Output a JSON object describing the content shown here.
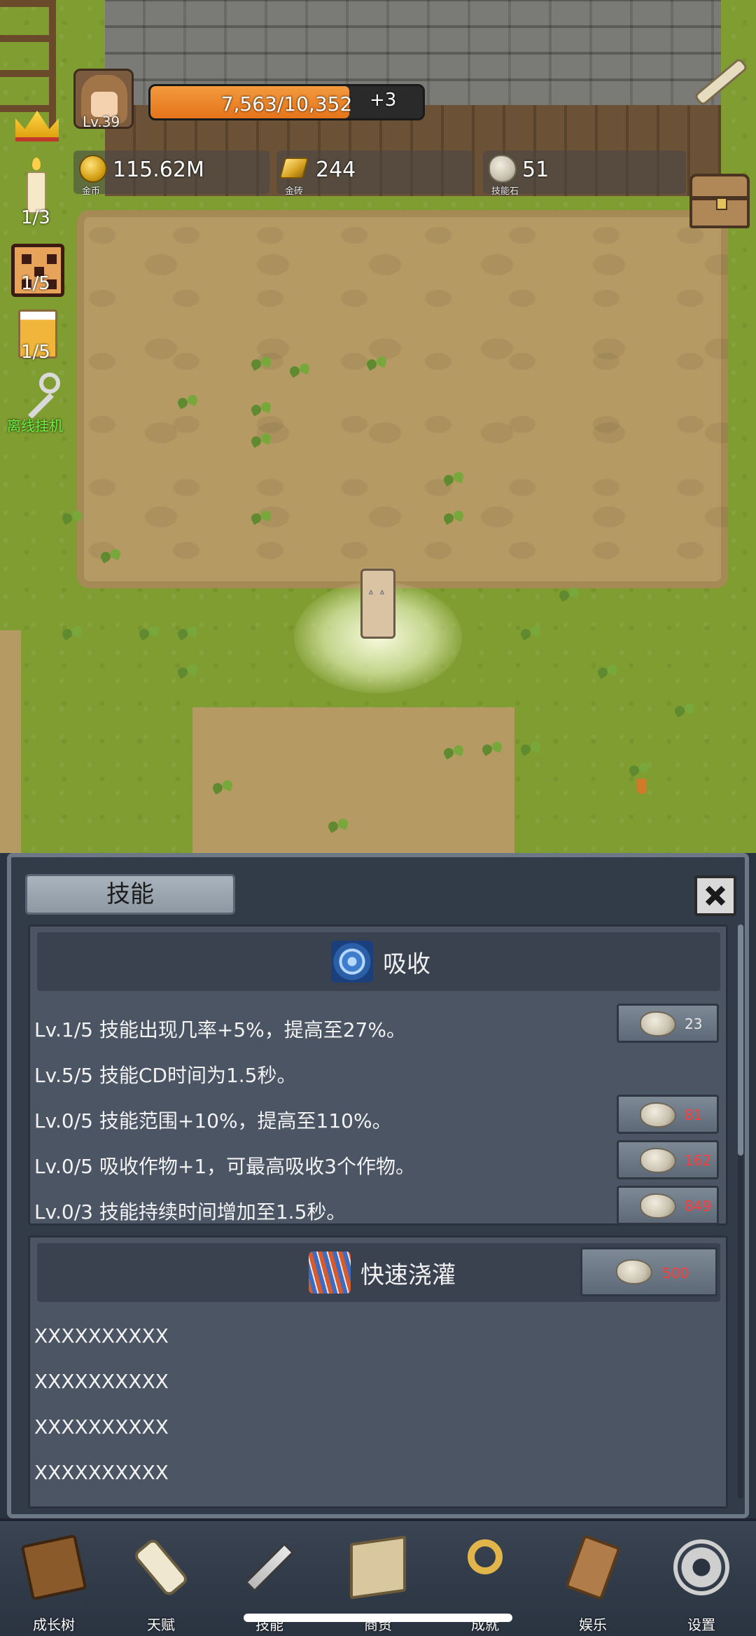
{
  "player": {
    "level": "Lv.39",
    "xp_text": "7,563/10,352",
    "xp_fraction": 0.7306,
    "xp_bonus": "+3"
  },
  "resources": [
    {
      "icon": "gold-coin-icon",
      "value": "115.62M",
      "label": "金币"
    },
    {
      "icon": "gold-bar-icon",
      "value": "244",
      "label": "金砖"
    },
    {
      "icon": "skill-stone-icon",
      "value": "51",
      "label": "技能石"
    }
  ],
  "side_items": {
    "candle_count": "1/3",
    "dice_count": "1/5",
    "beer_count": "1/5",
    "idle_label": "离线挂机"
  },
  "panel": {
    "tab_label": "技能",
    "skills": [
      {
        "name": "吸收",
        "icon": "swirl-icon",
        "upgrades": [
          {
            "text": "Lv.1/5 技能出现几率+5%，提高至27%。",
            "cost": "23",
            "cost_state": "affordable"
          },
          {
            "text": "Lv.5/5 技能CD时间为1.5秒。",
            "cost": "",
            "cost_state": "maxed"
          },
          {
            "text": "Lv.0/5 技能范围+10%，提高至110%。",
            "cost": "81",
            "cost_state": "unaffordable"
          },
          {
            "text": "Lv.0/5 吸收作物+1，可最高吸收3个作物。",
            "cost": "162",
            "cost_state": "unaffordable"
          },
          {
            "text": "Lv.0/3 技能持续时间增加至1.5秒。",
            "cost": "849",
            "cost_state": "unaffordable"
          }
        ]
      },
      {
        "name": "快速浇灌",
        "icon": "rain-icon",
        "unlock_cost": "500",
        "unlock_state": "unaffordable",
        "upgrades": [
          "XXXXXXXXXX",
          "XXXXXXXXXX",
          "XXXXXXXXXX",
          "XXXXXXXXXX"
        ]
      }
    ]
  },
  "nav": [
    {
      "label": "成长树",
      "icon": "book-icon"
    },
    {
      "label": "天赋",
      "icon": "scroll-icon"
    },
    {
      "label": "技能",
      "icon": "sword-icon"
    },
    {
      "label": "商贸",
      "icon": "map-icon"
    },
    {
      "label": "成就",
      "icon": "key-icon"
    },
    {
      "label": "娱乐",
      "icon": "parchment-icon"
    },
    {
      "label": "设置",
      "icon": "gear-icon"
    }
  ],
  "colors": {
    "xp_fill": "#e6741a",
    "cost_red": "#ff3b3b",
    "idle_green": "#6cf23e",
    "panel_bg": "#323b48"
  }
}
